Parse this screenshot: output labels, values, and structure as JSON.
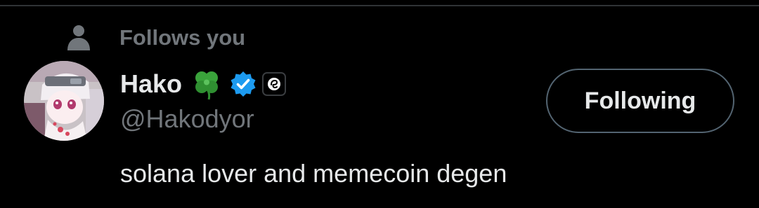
{
  "follows_badge": {
    "text": "Follows you",
    "icon": "person-icon"
  },
  "user": {
    "display_name": "Hako",
    "name_emoji": "four-leaf-clover-icon",
    "verified_icon": "verified-badge-icon",
    "affiliate_icon": "affiliate-badge-icon",
    "handle": "@Hakodyor",
    "bio": "solana lover and memecoin degen"
  },
  "actions": {
    "follow_state_label": "Following"
  },
  "colors": {
    "background": "#000000",
    "primary_text": "#e7e9ea",
    "secondary_text": "#71767b",
    "verified_blue": "#1d9bf0",
    "button_border": "#536471",
    "divider": "#2f3336"
  }
}
